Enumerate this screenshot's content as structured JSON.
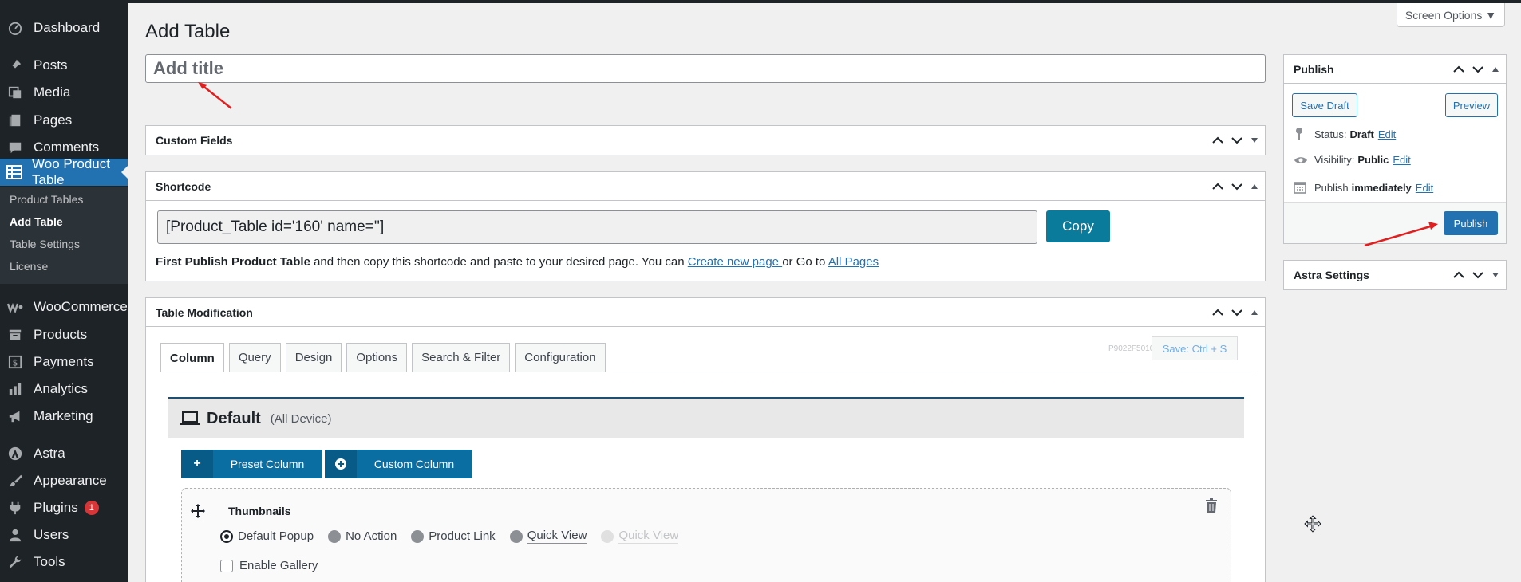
{
  "sidebar": {
    "items": [
      {
        "label": "Dashboard",
        "icon": "dashboard-icon"
      },
      {
        "label": "Posts",
        "icon": "pin-icon"
      },
      {
        "label": "Media",
        "icon": "media-icon"
      },
      {
        "label": "Pages",
        "icon": "pages-icon"
      },
      {
        "label": "Comments",
        "icon": "comment-icon"
      },
      {
        "label": "Woo Product Table",
        "icon": "table-icon"
      },
      {
        "label": "WooCommerce",
        "icon": "woocommerce-icon"
      },
      {
        "label": "Products",
        "icon": "archive-icon"
      },
      {
        "label": "Payments",
        "icon": "dollar-icon"
      },
      {
        "label": "Analytics",
        "icon": "bar-chart-icon"
      },
      {
        "label": "Marketing",
        "icon": "megaphone-icon"
      },
      {
        "label": "Astra",
        "icon": "astra-icon"
      },
      {
        "label": "Appearance",
        "icon": "brush-icon"
      },
      {
        "label": "Plugins",
        "icon": "plugin-icon",
        "badge": "1"
      },
      {
        "label": "Users",
        "icon": "user-icon"
      },
      {
        "label": "Tools",
        "icon": "wrench-icon"
      }
    ],
    "submenu": [
      "Product Tables",
      "Add Table",
      "Table Settings",
      "License"
    ]
  },
  "header": {
    "title": "Add Table",
    "screen_options": "Screen Options ▼",
    "title_placeholder": "Add title"
  },
  "custom_fields": {
    "title": "Custom Fields"
  },
  "shortcode": {
    "title": "Shortcode",
    "value": "[Product_Table id='160' name='']",
    "copy_label": "Copy",
    "desc_bold": "First Publish Product Table",
    "desc_text": " and then copy this shortcode and paste to your desired page. You can ",
    "link1": "Create new page ",
    "desc_mid": "or Go to ",
    "link2": "All Pages"
  },
  "table_mod": {
    "title": "Table Modification",
    "tabs": [
      "Column",
      "Query",
      "Design",
      "Options",
      "Search & Filter",
      "Configuration"
    ],
    "version": "P9022F5010",
    "save_label": "Save: Ctrl + S",
    "device_title": "Default",
    "device_sub": "(All Device)",
    "preset_label": "Preset Column",
    "custom_label": "Custom Column",
    "column_name": "Thumbnails",
    "options": [
      "Default Popup",
      "No Action",
      "Product Link",
      "Quick View",
      "Quick View"
    ],
    "gallery_label": "Enable Gallery"
  },
  "publish": {
    "title": "Publish",
    "save_draft": "Save Draft",
    "preview": "Preview",
    "status_label": "Status:",
    "status_value": "Draft",
    "visibility_label": "Visibility:",
    "visibility_value": "Public",
    "publish_label": "Publish",
    "publish_value": "immediately",
    "edit": "Edit",
    "publish_button": "Publish"
  },
  "astra": {
    "title": "Astra Settings"
  },
  "colors": {
    "sidebar_bg": "#1d2327",
    "accent": "#2271b1",
    "copy_btn": "#0b7b9b",
    "annotation": "#e02020"
  }
}
